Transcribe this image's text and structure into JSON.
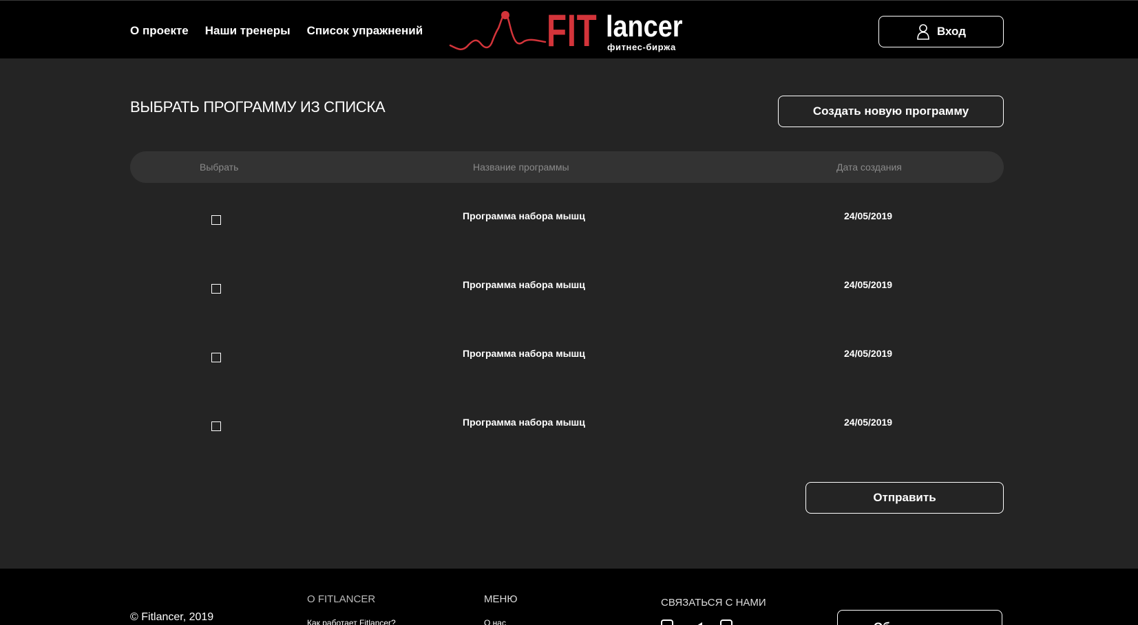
{
  "header": {
    "nav": [
      "О проекте",
      "Наши тренеры",
      "Список упражнений"
    ],
    "logo": {
      "fit": "FIT",
      "lancer": "lancer",
      "subtitle": "фитнес-биржа"
    },
    "login_label": "Вход",
    "icons": {
      "login": "user-icon"
    },
    "colors": {
      "brand_red": "#d3343a"
    }
  },
  "main": {
    "title": "ВЫБРАТЬ ПРОГРАММУ ИЗ СПИСКА",
    "create_label": "Создать новую программу",
    "table": {
      "columns": [
        "Выбрать",
        "Название программы",
        "Дата создания"
      ],
      "rows": [
        {
          "selected": false,
          "name": "Программа набора мышц",
          "date": "24/05/2019"
        },
        {
          "selected": false,
          "name": "Программа набора мышц",
          "date": "24/05/2019"
        },
        {
          "selected": false,
          "name": "Программа набора мышц",
          "date": "24/05/2019"
        },
        {
          "selected": false,
          "name": "Программа набора мышц",
          "date": "24/05/2019"
        }
      ]
    },
    "submit_label": "Отправить"
  },
  "footer": {
    "copyright": "© Fitlancer, 2019",
    "about": {
      "title": "О FITLANCER",
      "link": "Как работает Fitlancer?"
    },
    "menu": {
      "title": "МЕНЮ",
      "link": "О нас"
    },
    "contact": {
      "title": "СВЯЗАТЬСЯ С НАМИ",
      "icons": [
        "instagram-icon",
        "telegram-icon",
        "mail-icon"
      ]
    },
    "button_label": "Об"
  }
}
